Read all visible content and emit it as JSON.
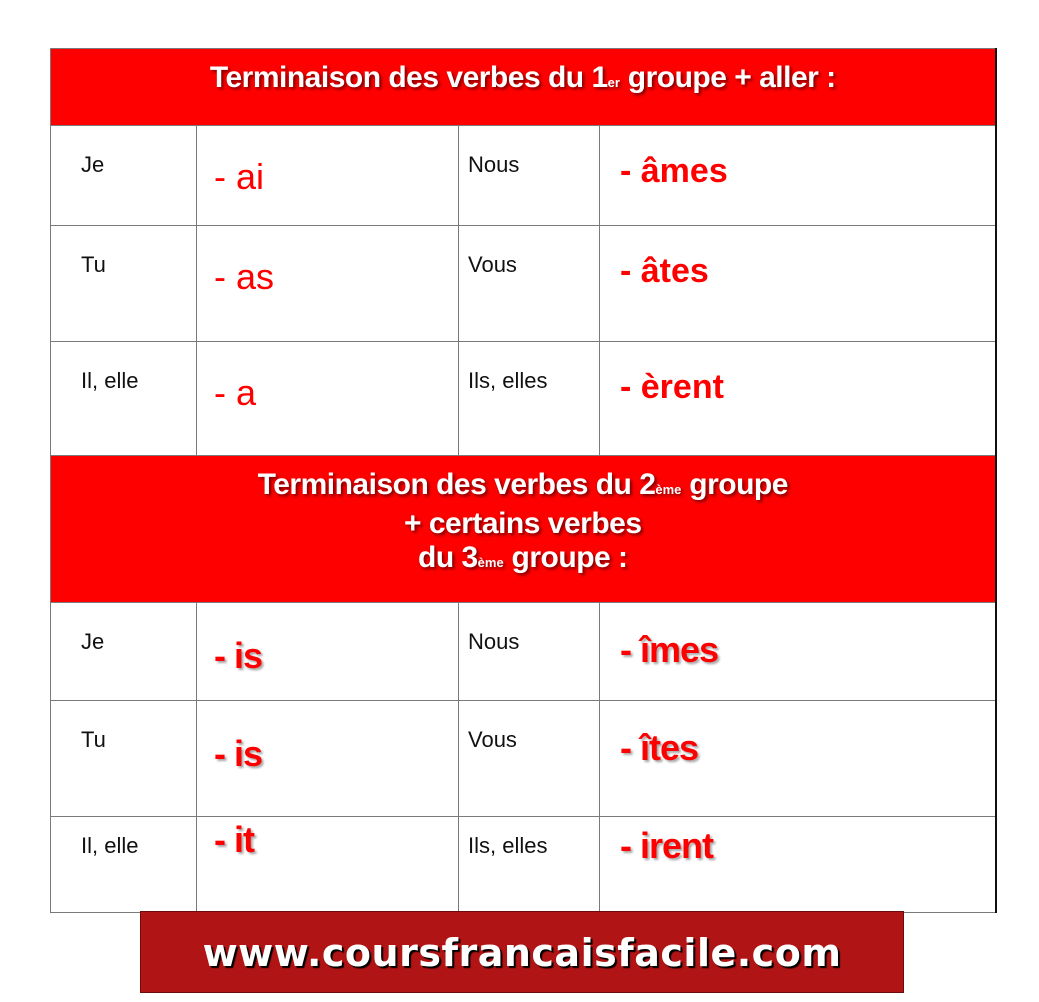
{
  "section1": {
    "title_pre": "Terminaison des verbes du 1",
    "title_sup": "er",
    "title_post": " groupe + aller :",
    "rows": [
      {
        "pronoun_sg": "Je",
        "ending_sg": "- ai",
        "pronoun_pl": "Nous",
        "ending_pl": "- âmes"
      },
      {
        "pronoun_sg": "Tu",
        "ending_sg": "- as",
        "pronoun_pl": "Vous",
        "ending_pl": "- âtes"
      },
      {
        "pronoun_sg": "Il, elle",
        "ending_sg": "- a",
        "pronoun_pl": "Ils, elles",
        "ending_pl": "- èrent"
      }
    ]
  },
  "section2": {
    "line1_pre": "Terminaison des verbes du 2",
    "line1_sup": "ème",
    "line1_post": " groupe",
    "line2": "+ certains verbes",
    "line3_pre": "du 3",
    "line3_sup": "ème",
    "line3_post": " groupe :",
    "rows": [
      {
        "pronoun_sg": "Je",
        "ending_sg": "- is",
        "pronoun_pl": "Nous",
        "ending_pl": "- îmes"
      },
      {
        "pronoun_sg": "Tu",
        "ending_sg": "- is",
        "pronoun_pl": "Vous",
        "ending_pl": "- îtes"
      },
      {
        "pronoun_sg": "Il, elle",
        "ending_sg": "- it",
        "pronoun_pl": "Ils, elles",
        "ending_pl": "- irent"
      }
    ]
  },
  "footer": {
    "website": "www.coursfrancaisfacile.com"
  },
  "colors": {
    "header_red": "#ff0000",
    "ending_red": "#ff0000",
    "banner_red": "#b01414"
  }
}
